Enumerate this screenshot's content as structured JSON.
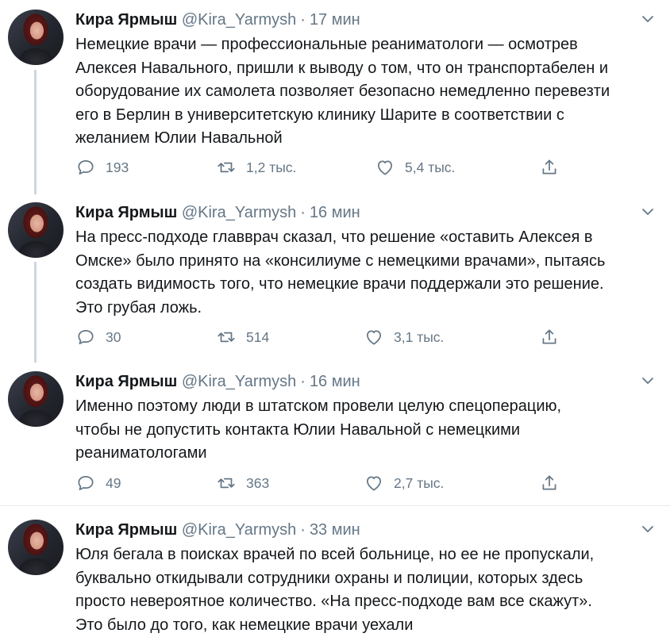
{
  "colors": {
    "text": "#14171a",
    "secondary": "#657786",
    "divider": "#e6ecf0",
    "thread_line": "#ccd6dd"
  },
  "tweets": [
    {
      "name": "Кира Ярмыш",
      "handle": "@Kira_Yarmysh",
      "separator": "·",
      "time": "17 мин",
      "lines": [
        "Немецкие врачи — профессиональные реаниматологи — осмотрев",
        "Алексея Навального, пришли к выводу о том, что он транспортабелен и",
        "оборудование их самолета позволяет безопасно немедленно перевезти",
        "его в Берлин в университетскую клинику Шарите в соответствии с",
        "желанием Юлии Навальной"
      ],
      "replies": "193",
      "retweets": "1,2 тыс.",
      "likes": "5,4 тыс."
    },
    {
      "name": "Кира Ярмыш",
      "handle": "@Kira_Yarmysh",
      "separator": "·",
      "time": "16 мин",
      "lines": [
        "На пресс-подходе главврач сказал, что решение «оставить Алексея в",
        "Омске» было принято на «консилиуме с немецкими врачами», пытаясь",
        "создать видимость того, что немецкие врачи поддержали это решение.",
        "Это грубая ложь."
      ],
      "replies": "30",
      "retweets": "514",
      "likes": "3,1 тыс."
    },
    {
      "name": "Кира Ярмыш",
      "handle": "@Kira_Yarmysh",
      "separator": "·",
      "time": "16 мин",
      "lines": [
        "Именно поэтому люди в штатском провели целую спецоперацию,",
        "чтобы не допустить контакта Юлии Навальной с немецкими",
        "реаниматологами"
      ],
      "replies": "49",
      "retweets": "363",
      "likes": "2,7 тыс."
    },
    {
      "name": "Кира Ярмыш",
      "handle": "@Kira_Yarmysh",
      "separator": "·",
      "time": "33 мин",
      "lines": [
        "Юля бегала в поисках врачей по всей больнице, но ее не пропускали,",
        "буквально откидывали сотрудники охраны и полиции, которых здесь",
        "просто невероятное количество. «На пресс-подходе вам все скажут».",
        "Это было до того, как немецкие врачи уехали"
      ]
    }
  ]
}
